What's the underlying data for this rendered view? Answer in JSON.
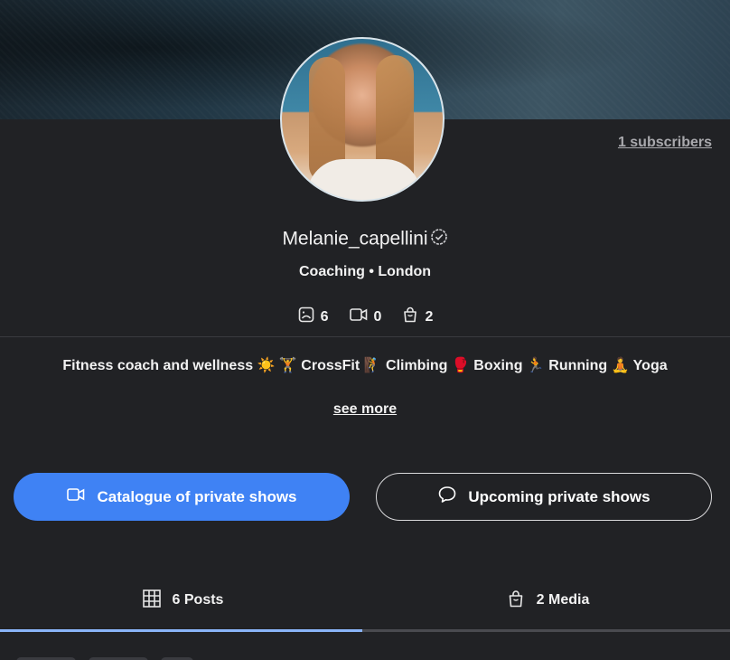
{
  "profile": {
    "subscribers_text": "1 subscribers",
    "username": "Melanie_capellini",
    "subtitle": "Coaching • London",
    "stats": {
      "photos": "6",
      "videos": "0",
      "products": "2"
    },
    "bio": "Fitness coach and wellness ☀️ 🏋️ CrossFit 🧗 Climbing 🥊 Boxing 🏃 Running 🧘 Yoga",
    "see_more": "see more"
  },
  "buttons": {
    "catalogue": "Catalogue of private shows",
    "upcoming": "Upcoming private shows"
  },
  "tabs": {
    "posts": "6 Posts",
    "media": "2 Media"
  },
  "colors": {
    "background": "#212225",
    "primary": "#3f82f4",
    "tab_active": "#8ab4f8"
  }
}
